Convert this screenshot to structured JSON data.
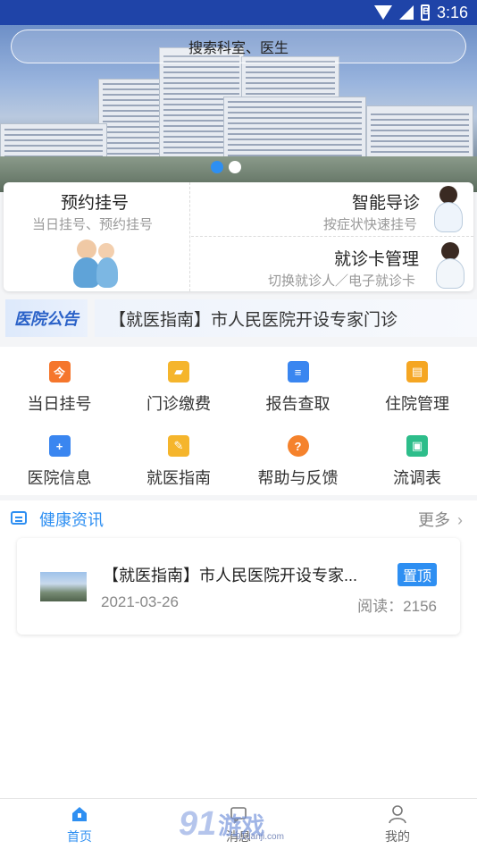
{
  "status_bar": {
    "time": "3:16",
    "battery": "B"
  },
  "search": {
    "placeholder": "搜索科室、医生"
  },
  "banner": {
    "dot_count": 2,
    "active_dot": 0
  },
  "quick": {
    "appointment": {
      "title": "预约挂号",
      "subtitle": "当日挂号、预约挂号"
    },
    "smart_guide": {
      "title": "智能导诊",
      "subtitle": "按症状快速挂号"
    },
    "card_manage": {
      "title": "就诊卡管理",
      "subtitle": "切换就诊人／电子就诊卡"
    }
  },
  "notice": {
    "logo_text": "医院公告",
    "text": "【就医指南】市人民医院开设专家门诊"
  },
  "grid": [
    {
      "label": "当日挂号",
      "icon": "calendar-today-icon",
      "color": "#f5762c"
    },
    {
      "label": "门诊缴费",
      "icon": "wallet-icon",
      "color": "#f5b52c"
    },
    {
      "label": "报告查取",
      "icon": "report-search-icon",
      "color": "#3a86f0"
    },
    {
      "label": "住院管理",
      "icon": "inpatient-icon",
      "color": "#f5a623"
    },
    {
      "label": "医院信息",
      "icon": "hospital-icon",
      "color": "#3a86f0"
    },
    {
      "label": "就医指南",
      "icon": "guide-icon",
      "color": "#f5b52c"
    },
    {
      "label": "帮助与反馈",
      "icon": "help-icon",
      "color": "#f5822c"
    },
    {
      "label": "流调表",
      "icon": "survey-icon",
      "color": "#2dbd8a"
    }
  ],
  "news": {
    "title": "健康资讯",
    "more": "更多",
    "items": [
      {
        "headline": "【就医指南】市人民医院开设专家...",
        "badge": "置顶",
        "date": "2021-03-26",
        "reads": "阅读：2156"
      }
    ]
  },
  "tabbar": {
    "home": "首页",
    "messages": "消息",
    "mine": "我的"
  },
  "watermark": {
    "brand": "91",
    "text": "游戏",
    "url": "91danji.com"
  },
  "colors": {
    "accent": "#2e8ff2",
    "status_bar": "#1f44a8"
  }
}
